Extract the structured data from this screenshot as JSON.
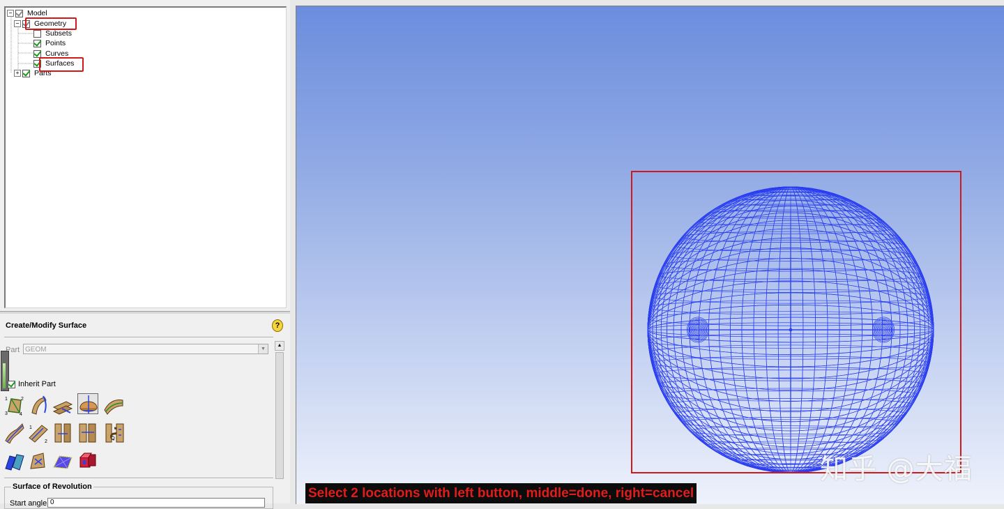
{
  "tree": {
    "root": "Model",
    "geometry": "Geometry",
    "subsets": "Subsets",
    "points": "Points",
    "curves": "Curves",
    "surfaces": "Surfaces",
    "parts": "Parts"
  },
  "panel": {
    "title": "Create/Modify Surface",
    "part_label": "Part",
    "part_value": "GEOM",
    "inherit_label": "Inherit Part",
    "tools": [
      "from-curves-icon",
      "curtain-surface-icon",
      "offset-surface-icon",
      "surface-of-revolution-icon",
      "loft-surface-icon",
      "sweep-surface-icon",
      "midsurface-icon",
      "segment-surface-icon",
      "trim-surface-icon",
      "merge-surface-icon",
      "untrim-surface-icon",
      "extend-surface-icon",
      "geometry-from-faceted-icon",
      "create-faceted-icon",
      "convert-faceted-icon",
      "standard-shapes-icon"
    ],
    "section_title": "Surface of Revolution",
    "start_label": "Start angle",
    "start_value": "0"
  },
  "viewport": {
    "status_message": "Select 2 locations with left button, middle=done, right=cancel",
    "mesh_color": "#2b3ff0",
    "highlight_color": "#d01a1a"
  },
  "watermark": "知乎 @大福"
}
